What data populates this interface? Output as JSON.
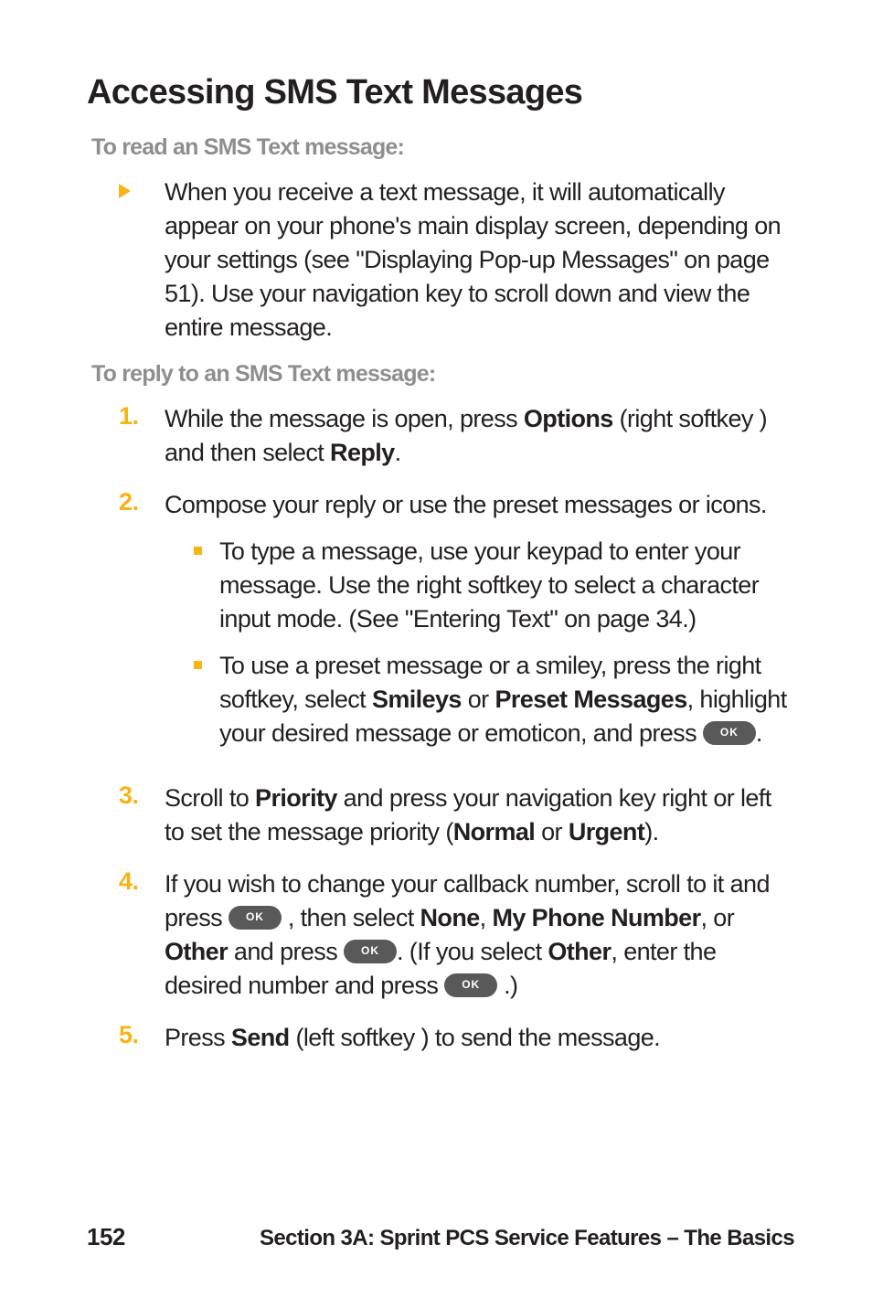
{
  "title": "Accessing SMS Text Messages",
  "sub1": "To read an SMS Text message:",
  "read_bullet": "When you receive a text message, it will automatically appear on your phone's main display screen, depending on your settings (see \"Displaying Pop-up Messages\" on page 51). Use your navigation key to scroll down and view the entire message.",
  "sub2": "To reply to an SMS Text message:",
  "steps": {
    "s1a": "While the message is open, press ",
    "s1_options": "Options",
    "s1b": " (right softkey ) and then select ",
    "s1_reply": "Reply",
    "s1c": ".",
    "s2": "Compose your reply or use the preset messages or icons.",
    "s2_i1": "To type a message, use your keypad to enter your message. Use the right softkey to select a character input mode. (See \"Entering Text\" on page 34.)",
    "s2_i2a": "To use a preset message or a smiley, press the right softkey, select ",
    "s2_i2_smileys": "Smileys",
    "s2_i2b": " or ",
    "s2_i2_preset": "Preset Messages",
    "s2_i2c": ", highlight your desired message or emoticon, and press ",
    "s2_i2d": ".",
    "s3a": "Scroll to ",
    "s3_priority": "Priority",
    "s3b": " and press your navigation key right or left to set the message priority (",
    "s3_normal": "Normal",
    "s3c": " or ",
    "s3_urgent": "Urgent",
    "s3d": ").",
    "s4a": "If you wish to change your callback number, scroll to it and press ",
    "s4b": " , then select ",
    "s4_none": "None",
    "s4c": ", ",
    "s4_myphone": "My Phone Number",
    "s4d": ", or ",
    "s4_other": "Other",
    "s4e": " and press ",
    "s4f": ". (If you select ",
    "s4_other2": "Other",
    "s4g": ", enter the desired number and press ",
    "s4h": " .)",
    "s5a": "Press ",
    "s5_send": "Send",
    "s5b": " (left softkey ) to send the message."
  },
  "numbers": {
    "n1": "1.",
    "n2": "2.",
    "n3": "3.",
    "n4": "4.",
    "n5": "5."
  },
  "ok_label": "OK",
  "footer": {
    "page": "152",
    "section": "Section 3A: Sprint PCS Service Features – The Basics"
  }
}
